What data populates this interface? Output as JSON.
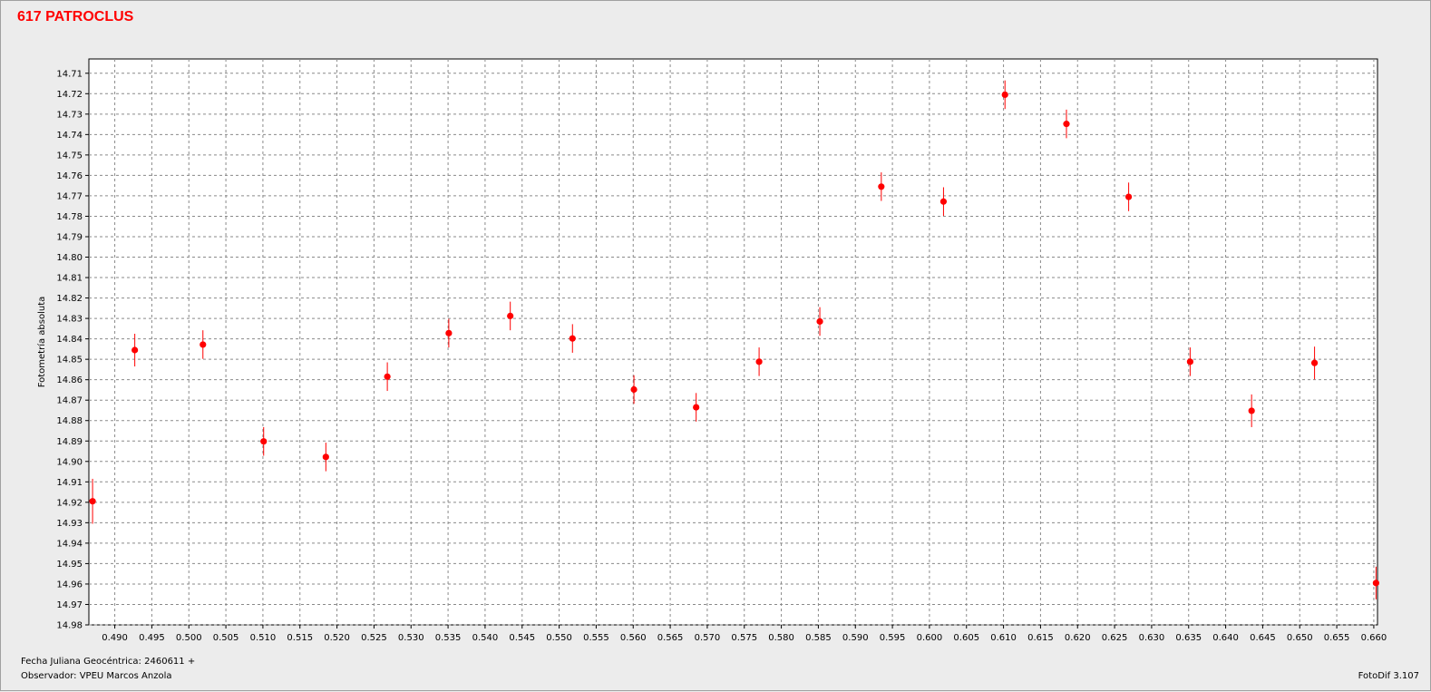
{
  "window": {
    "title": "617 PATROCLUS"
  },
  "footer": {
    "jd_label": "Fecha Juliana Geocéntrica:",
    "jd_value": "2460611 +",
    "observer_label": "Observador:",
    "observer_value": "VPEU Marcos Anzola",
    "software": "FotoDif 3.107"
  },
  "chart_data": {
    "type": "scatter",
    "title": "617 PATROCLUS",
    "xlabel": "",
    "ylabel": "Fotometría absoluta",
    "xlim": [
      0.4865,
      0.6605
    ],
    "ylim": [
      14.703,
      14.98
    ],
    "y_inverted": true,
    "grid": true,
    "point_color": "#ff0000",
    "x_ticks": [
      0.49,
      0.495,
      0.5,
      0.505,
      0.51,
      0.515,
      0.52,
      0.525,
      0.53,
      0.535,
      0.54,
      0.545,
      0.55,
      0.555,
      0.56,
      0.565,
      0.57,
      0.575,
      0.58,
      0.585,
      0.59,
      0.595,
      0.6,
      0.605,
      0.61,
      0.615,
      0.62,
      0.625,
      0.63,
      0.635,
      0.64,
      0.645,
      0.65,
      0.655,
      0.66
    ],
    "x_tick_labels": [
      "0.490",
      "0.495",
      "0.500",
      "0.505",
      "0.510",
      "0.515",
      "0.520",
      "0.525",
      "0.530",
      "0.535",
      "0.540",
      "0.545",
      "0.550",
      "0.555",
      "0.560",
      "0.565",
      "0.570",
      "0.575",
      "0.580",
      "0.585",
      "0.590",
      "0.595",
      "0.600",
      "0.605",
      "0.610",
      "0.615",
      "0.620",
      "0.625",
      "0.630",
      "0.635",
      "0.640",
      "0.645",
      "0.650",
      "0.655",
      "0.660"
    ],
    "y_ticks": [
      14.71,
      14.72,
      14.73,
      14.74,
      14.75,
      14.76,
      14.77,
      14.78,
      14.79,
      14.8,
      14.81,
      14.82,
      14.83,
      14.84,
      14.85,
      14.86,
      14.87,
      14.88,
      14.89,
      14.9,
      14.91,
      14.92,
      14.93,
      14.94,
      14.95,
      14.96,
      14.97,
      14.98
    ],
    "y_tick_labels": [
      "14.71",
      "14.72",
      "14.73",
      "14.74",
      "14.75",
      "14.76",
      "14.77",
      "14.78",
      "14.79",
      "14.80",
      "14.81",
      "14.82",
      "14.83",
      "14.84",
      "14.85",
      "14.86",
      "14.87",
      "14.88",
      "14.89",
      "14.90",
      "14.91",
      "14.92",
      "14.93",
      "14.94",
      "14.95",
      "14.96",
      "14.97",
      "14.98"
    ],
    "series": [
      {
        "points": [
          {
            "x": 0.487,
            "y": 14.9195,
            "err": 0.011
          },
          {
            "x": 0.4927,
            "y": 14.8455,
            "err": 0.008
          },
          {
            "x": 0.5019,
            "y": 14.8428,
            "err": 0.007
          },
          {
            "x": 0.5101,
            "y": 14.8902,
            "err": 0.007
          },
          {
            "x": 0.5185,
            "y": 14.8978,
            "err": 0.007
          },
          {
            "x": 0.5268,
            "y": 14.8585,
            "err": 0.007
          },
          {
            "x": 0.5351,
            "y": 14.8372,
            "err": 0.007
          },
          {
            "x": 0.5434,
            "y": 14.8288,
            "err": 0.007
          },
          {
            "x": 0.5518,
            "y": 14.8398,
            "err": 0.007
          },
          {
            "x": 0.5601,
            "y": 14.8648,
            "err": 0.007
          },
          {
            "x": 0.5685,
            "y": 14.8735,
            "err": 0.007
          },
          {
            "x": 0.577,
            "y": 14.8512,
            "err": 0.007
          },
          {
            "x": 0.5852,
            "y": 14.8315,
            "err": 0.007
          },
          {
            "x": 0.5935,
            "y": 14.7655,
            "err": 0.007
          },
          {
            "x": 0.6019,
            "y": 14.7728,
            "err": 0.007
          },
          {
            "x": 0.6102,
            "y": 14.7205,
            "err": 0.007
          },
          {
            "x": 0.6185,
            "y": 14.7348,
            "err": 0.007
          },
          {
            "x": 0.6269,
            "y": 14.7705,
            "err": 0.007
          },
          {
            "x": 0.6352,
            "y": 14.8512,
            "err": 0.007
          },
          {
            "x": 0.6435,
            "y": 14.8752,
            "err": 0.008
          },
          {
            "x": 0.652,
            "y": 14.8518,
            "err": 0.008
          },
          {
            "x": 0.6603,
            "y": 14.9595,
            "err": 0.008
          }
        ]
      }
    ]
  }
}
